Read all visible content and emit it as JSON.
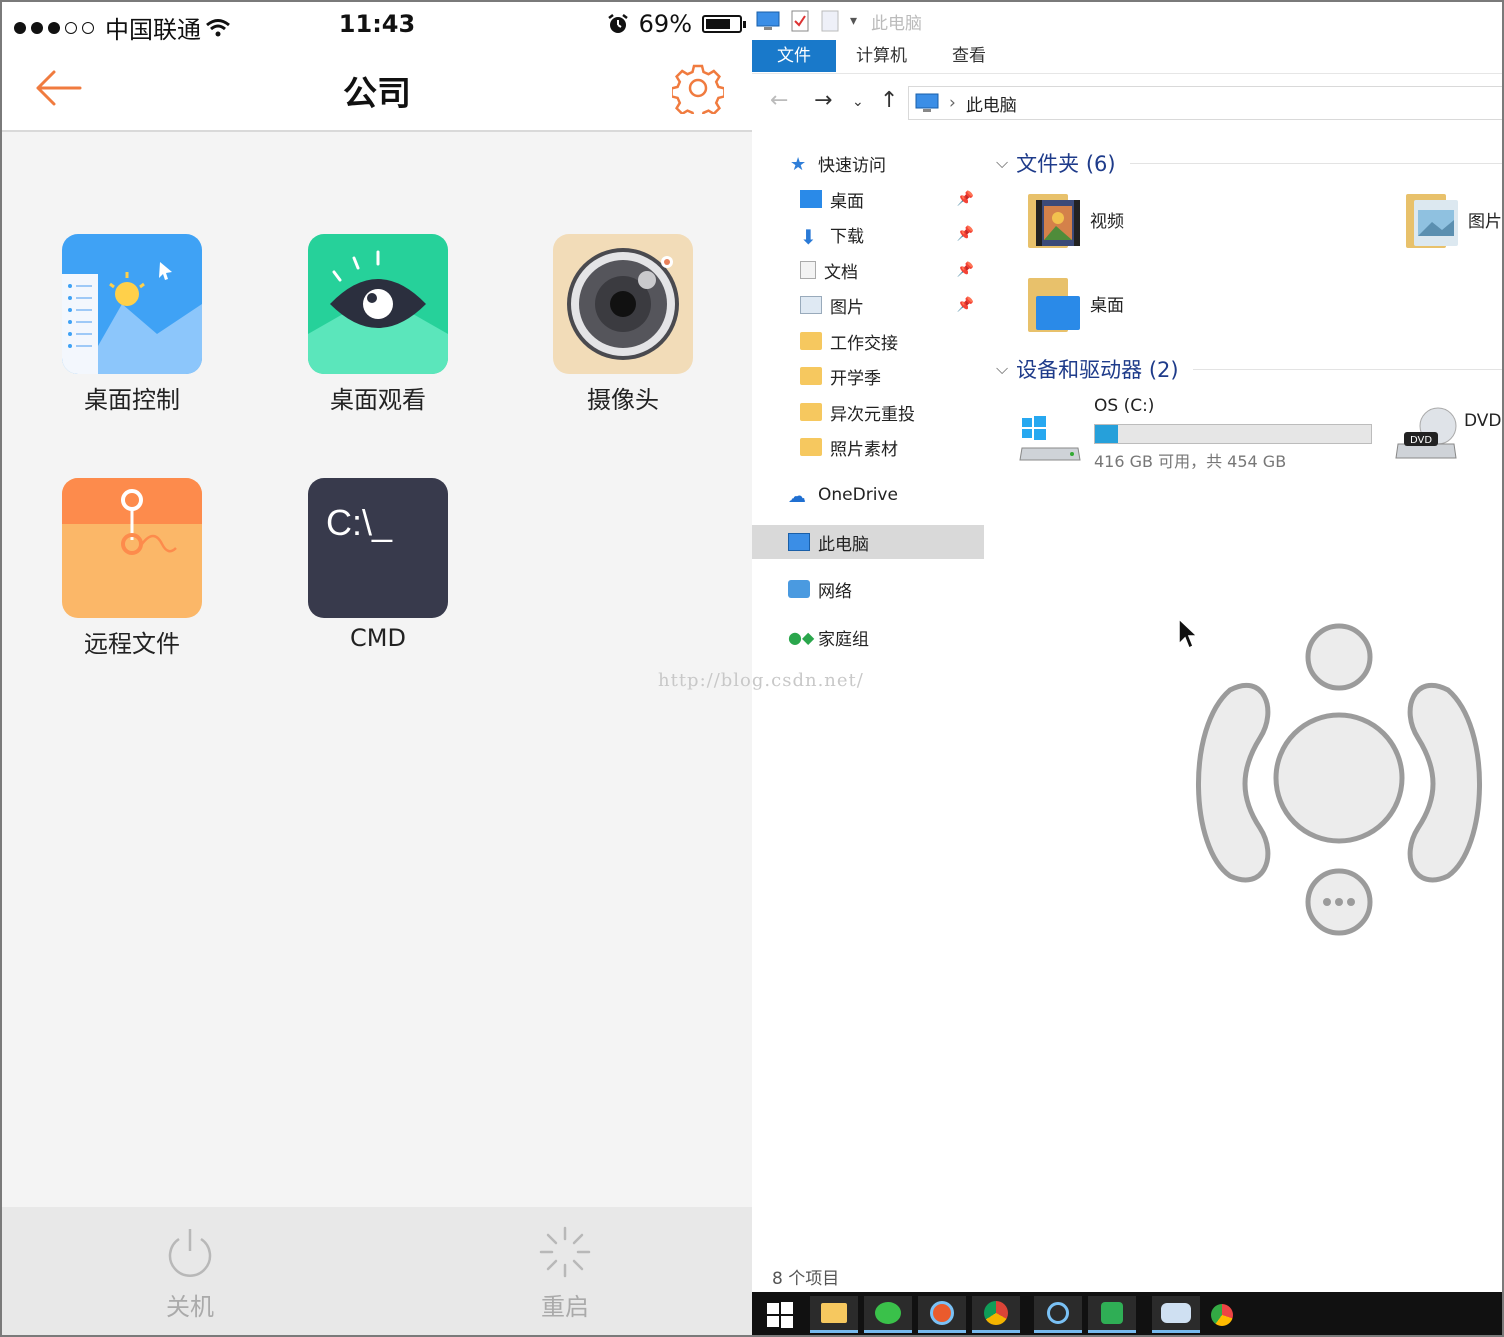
{
  "phone": {
    "status_bar": {
      "carrier": "中国联通",
      "time": "11:43",
      "battery": "69%"
    },
    "nav": {
      "title": "公司"
    },
    "tiles": [
      {
        "label": "桌面控制"
      },
      {
        "label": "桌面观看"
      },
      {
        "label": "摄像头"
      },
      {
        "label": "远程文件"
      },
      {
        "label": "CMD",
        "icon_text": "C:\\_"
      }
    ],
    "bottom": {
      "shutdown_label": "关机",
      "restart_label": "重启"
    },
    "colors": {
      "accent": "#f07b3f",
      "tile_blue": "#3fa2f5",
      "tile_green": "#26d19a",
      "tile_camera": "#f2dcb8",
      "tile_file": "#fbb768",
      "tile_cmd": "#383a4c"
    }
  },
  "watermark": "http://blog.csdn.net/",
  "explorer": {
    "quick_access_title": "此电脑",
    "ribbon_tabs": [
      "文件",
      "计算机",
      "查看"
    ],
    "address": {
      "path": "此电脑"
    },
    "tree": [
      {
        "label": "快速访问"
      },
      {
        "label": "桌面"
      },
      {
        "label": "下载"
      },
      {
        "label": "文档"
      },
      {
        "label": "图片"
      },
      {
        "label": "工作交接"
      },
      {
        "label": "开学季"
      },
      {
        "label": "异次元重投"
      },
      {
        "label": "照片素材"
      },
      {
        "label": "OneDrive"
      },
      {
        "label": "此电脑"
      },
      {
        "label": "网络"
      },
      {
        "label": "家庭组"
      }
    ],
    "folders_group": "文件夹 (6)",
    "folders": [
      {
        "label": "视频"
      },
      {
        "label": "图片"
      },
      {
        "label": "桌面"
      }
    ],
    "devices_group": "设备和驱动器 (2)",
    "drive": {
      "name": "OS (C:)",
      "free_text": "416 GB 可用，共 454 GB",
      "used_fraction": 0.084
    },
    "dvd": {
      "name": "DVD",
      "badge": "DVD"
    },
    "status": "8 个项目",
    "colors": {
      "ribbon_file": "#1979ca",
      "group_header": "#1e3b8a",
      "drive_fill": "#26a0da"
    }
  }
}
